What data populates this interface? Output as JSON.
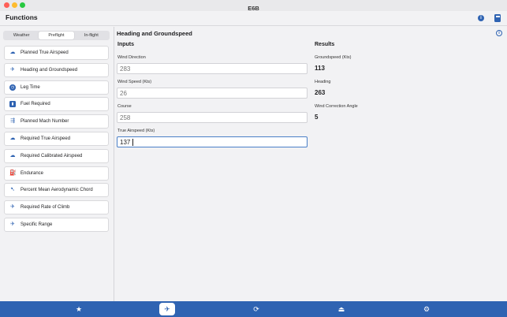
{
  "window": {
    "title": "E6B"
  },
  "header": {
    "title": "Functions"
  },
  "segments": [
    {
      "label": "Weather",
      "active": false
    },
    {
      "label": "Preflight",
      "active": true
    },
    {
      "label": "In-flight",
      "active": false
    }
  ],
  "functions": [
    {
      "label": "Planned True Airspeed",
      "icon": "cloud-icon"
    },
    {
      "label": "Heading and Groundspeed",
      "icon": "plane-icon"
    },
    {
      "label": "Leg Time",
      "icon": "clock-icon"
    },
    {
      "label": "Fuel Required",
      "icon": "fuel-pump-icon"
    },
    {
      "label": "Planned Mach Number",
      "icon": "mach-icon"
    },
    {
      "label": "Required True Airspeed",
      "icon": "cloud-icon"
    },
    {
      "label": "Required Calibrated Airspeed",
      "icon": "cloud-icon"
    },
    {
      "label": "Endurance",
      "icon": "endurance-icon"
    },
    {
      "label": "Percent Mean Aerodynamic Chord",
      "icon": "wing-icon"
    },
    {
      "label": "Required Rate of Climb",
      "icon": "plane-climb-icon"
    },
    {
      "label": "Specific Range",
      "icon": "plane-range-icon"
    }
  ],
  "main": {
    "title": "Heading and Groundspeed",
    "inputs_heading": "Inputs",
    "results_heading": "Results",
    "inputs": [
      {
        "label": "Wind Direction",
        "value": "",
        "placeholder": "283"
      },
      {
        "label": "Wind Speed (Kts)",
        "value": "",
        "placeholder": "26"
      },
      {
        "label": "Course",
        "value": "",
        "placeholder": "258"
      },
      {
        "label": "True Airspeed (Kts)",
        "value": "137",
        "placeholder": ""
      }
    ],
    "results": [
      {
        "label": "Groundspeed (Kts)",
        "value": "113"
      },
      {
        "label": "Heading",
        "value": "263"
      },
      {
        "label": "Wind Correction Angle",
        "value": "5"
      }
    ]
  },
  "tabbar": [
    {
      "name": "favorites-star-icon",
      "active": false
    },
    {
      "name": "functions-plane-icon",
      "active": true
    },
    {
      "name": "conversions-sync-icon",
      "active": false
    },
    {
      "name": "flight-bag-icon",
      "active": false
    },
    {
      "name": "settings-gear-icon",
      "active": false
    }
  ],
  "colors": {
    "accent": "#2f63b2",
    "placeholder": "#5b82c4",
    "background": "#f2f2f4"
  }
}
